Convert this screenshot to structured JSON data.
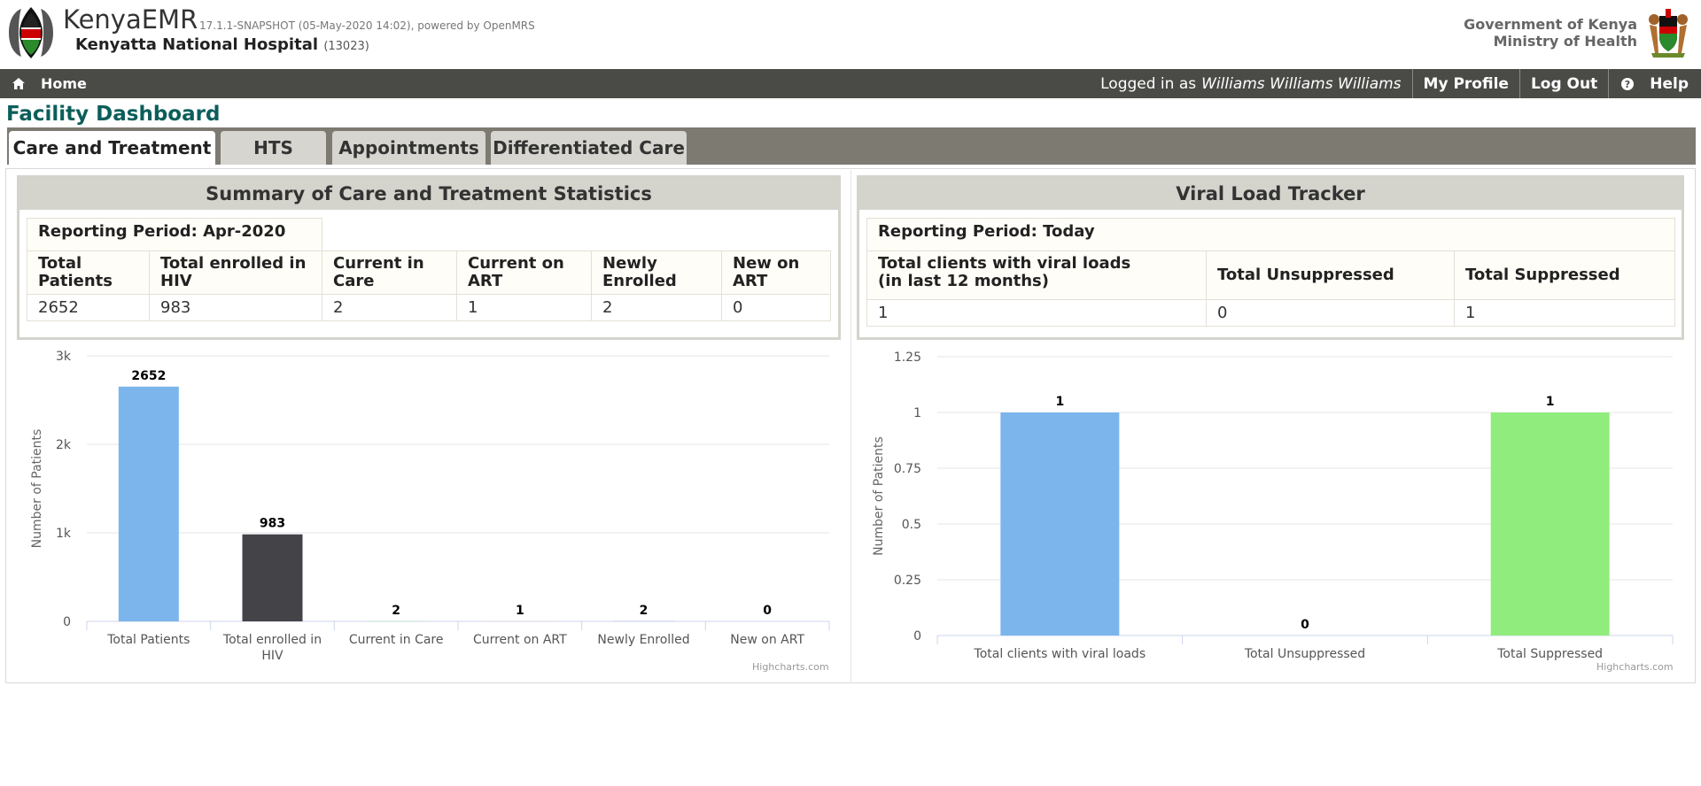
{
  "header": {
    "app_name": "KenyaEMR",
    "version": "17.1.1-SNAPSHOT (05-May-2020 14:02), powered by OpenMRS",
    "facility_name": "Kenyatta National Hospital",
    "facility_code": "(13023)",
    "gov_line1": "Government of Kenya",
    "gov_line2": "Ministry of Health"
  },
  "nav": {
    "home": "Home",
    "logged_in_prefix": "Logged in as",
    "user": "Williams Williams Williams",
    "my_profile": "My Profile",
    "log_out": "Log Out",
    "help": "Help"
  },
  "page_title": "Facility Dashboard",
  "tabs": [
    {
      "label": "Care and Treatment"
    },
    {
      "label": "HTS"
    },
    {
      "label": "Appointments"
    },
    {
      "label": "Differentiated Care"
    }
  ],
  "colors": {
    "accent": "#0b5e5a",
    "nav": "#4a4a47",
    "bar_blue": "#7cb5ec",
    "bar_dark": "#434348",
    "bar_green": "#90ed7d"
  },
  "care_panel": {
    "title": "Summary of Care and Treatment Statistics",
    "period": "Reporting Period: Apr-2020",
    "headers": [
      [
        "Total",
        "Patients"
      ],
      [
        "Total enrolled in",
        "HIV"
      ],
      [
        "Current in",
        "Care"
      ],
      [
        "Current on",
        "ART"
      ],
      [
        "Newly",
        "Enrolled"
      ],
      [
        "New on",
        "ART"
      ]
    ],
    "values": [
      "2652",
      "983",
      "2",
      "1",
      "2",
      "0"
    ]
  },
  "vl_panel": {
    "title": "Viral Load Tracker",
    "period": "Reporting Period: Today",
    "headers": [
      [
        "Total clients with viral loads",
        "(in last 12 months)"
      ],
      [
        "Total Unsuppressed",
        ""
      ],
      [
        "Total Suppressed",
        ""
      ]
    ],
    "values": [
      "1",
      "0",
      "1"
    ]
  },
  "chart_data": [
    {
      "type": "bar",
      "categories": [
        "Total Patients",
        "Total enrolled in HIV",
        "Current in Care",
        "Current on ART",
        "Newly Enrolled",
        "New on ART"
      ],
      "values": [
        2652,
        983,
        2,
        1,
        2,
        0
      ],
      "colors": [
        "#7cb5ec",
        "#434348",
        "#90ed7d",
        "#f7a35c",
        "#8085e9",
        "#f15c80"
      ],
      "ylabel": "Number of Patients",
      "yticks": [
        "0",
        "1k",
        "2k",
        "3k"
      ],
      "ylim": [
        0,
        3000
      ],
      "grid": true,
      "credits": "Highcharts.com"
    },
    {
      "type": "bar",
      "categories": [
        "Total clients with viral loads",
        "Total Unsuppressed",
        "Total Suppressed"
      ],
      "values": [
        1,
        0,
        1
      ],
      "colors": [
        "#7cb5ec",
        "#434348",
        "#90ed7d"
      ],
      "ylabel": "Number of Patients",
      "yticks": [
        "0",
        "0.25",
        "0.5",
        "0.75",
        "1",
        "1.25"
      ],
      "ylim": [
        0,
        1.25
      ],
      "grid": true,
      "credits": "Highcharts.com"
    }
  ]
}
